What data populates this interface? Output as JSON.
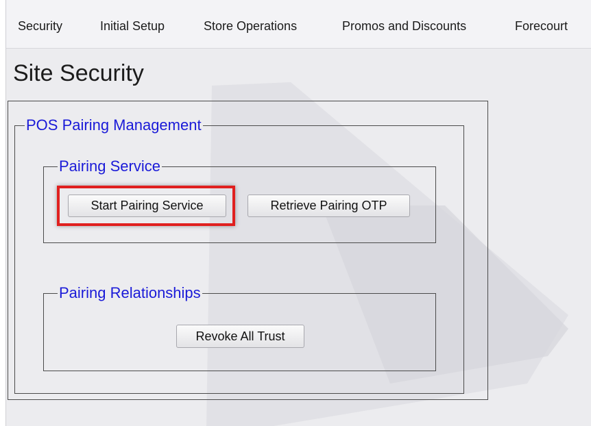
{
  "nav": {
    "items": [
      {
        "label": "Security"
      },
      {
        "label": "Initial Setup"
      },
      {
        "label": "Store Operations"
      },
      {
        "label": "Promos and Discounts"
      },
      {
        "label": "Forecourt"
      }
    ]
  },
  "page": {
    "title": "Site Security"
  },
  "pos_pairing": {
    "legend": "POS Pairing Management",
    "pairing_service": {
      "legend": "Pairing Service",
      "start_label": "Start Pairing Service",
      "retrieve_label": "Retrieve Pairing OTP"
    },
    "pairing_relationships": {
      "legend": "Pairing Relationships",
      "revoke_label": "Revoke All Trust"
    }
  },
  "colors": {
    "legend_text": "#1a1ad8",
    "highlight": "#e0201f",
    "background": "#ececef"
  }
}
